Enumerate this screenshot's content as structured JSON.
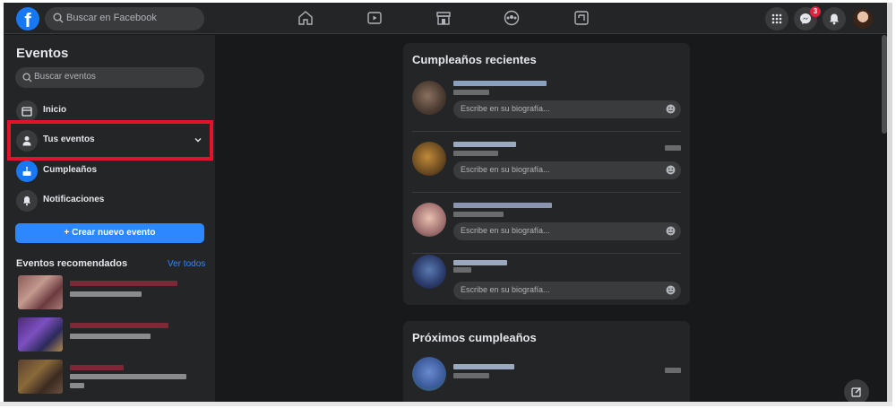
{
  "topbar": {
    "logo": "f",
    "search_placeholder": "Buscar en Facebook",
    "nav_icons": [
      "home-icon",
      "watch-icon",
      "marketplace-icon",
      "groups-icon",
      "gaming-icon"
    ],
    "messenger_badge": "3"
  },
  "sidebar": {
    "title": "Eventos",
    "search_placeholder": "Buscar eventos",
    "items": [
      {
        "label": "Inicio",
        "icon": "calendar-icon"
      },
      {
        "label": "Tus eventos",
        "icon": "person-icon"
      },
      {
        "label": "Cumpleaños",
        "icon": "cake-icon"
      },
      {
        "label": "Notificaciones",
        "icon": "bell-icon"
      }
    ],
    "create_button": "+ Crear nuevo evento",
    "recommended_title": "Eventos recomendados",
    "see_all": "Ver todos"
  },
  "main": {
    "recent_title": "Cumpleaños recientes",
    "upcoming_title": "Próximos cumpleaños",
    "post_placeholder": "Escribe en su biografía..."
  },
  "colors": {
    "accent": "#1877f2",
    "highlight_border": "#e3132b",
    "surface": "#242526",
    "background": "#18191a"
  }
}
